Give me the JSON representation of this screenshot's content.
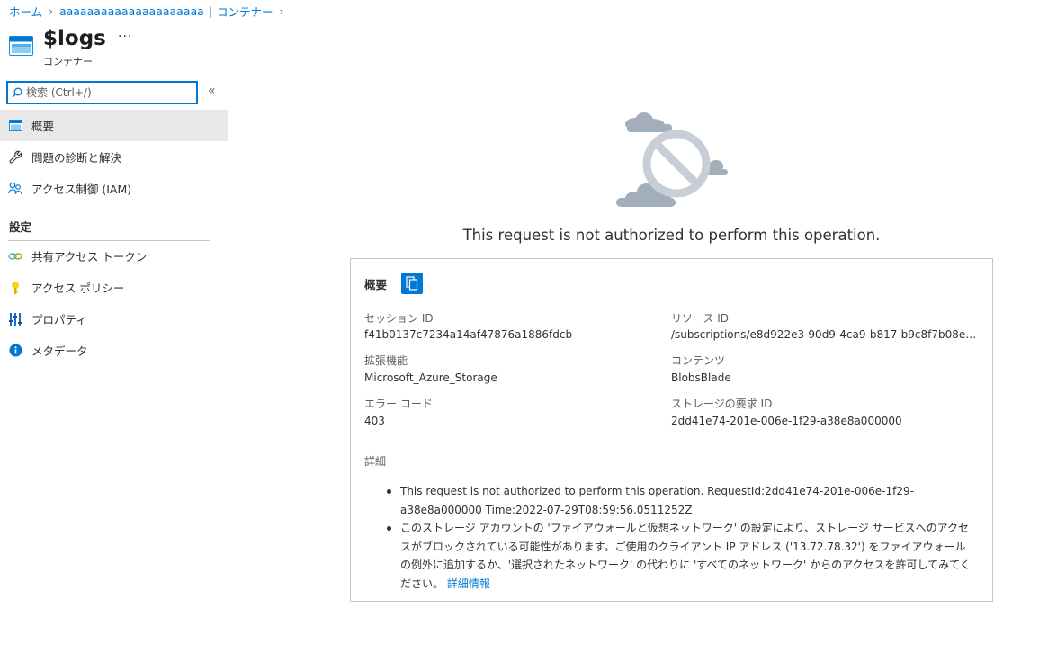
{
  "breadcrumb": {
    "home": "ホーム",
    "account": "aaaaaaaaaaaaaaaaaaaaa",
    "separator_pipe": "|",
    "containers": "コンテナー"
  },
  "header": {
    "title": "$logs",
    "subtitle": "コンテナー",
    "more": "···"
  },
  "search": {
    "placeholder": "検索 (Ctrl+/)",
    "value": ""
  },
  "nav": {
    "items": [
      {
        "label": "概要",
        "icon": "container-icon",
        "active": true
      },
      {
        "label": "問題の診断と解決",
        "icon": "wrench-icon",
        "active": false
      },
      {
        "label": "アクセス制御 (IAM)",
        "icon": "people-icon",
        "active": false
      }
    ],
    "settings_header": "設定",
    "settings_items": [
      {
        "label": "共有アクセス トークン",
        "icon": "link-icon"
      },
      {
        "label": "アクセス ポリシー",
        "icon": "key-icon"
      },
      {
        "label": "プロパティ",
        "icon": "properties-icon"
      },
      {
        "label": "メタデータ",
        "icon": "info-icon"
      }
    ]
  },
  "error": {
    "title": "This request is not authorized to perform this operation.",
    "summary_header": "概要",
    "fields": {
      "session_id_label": "セッション ID",
      "session_id_value": "f41b0137c7234a14af47876a1886fdcb",
      "resource_id_label": "リソース ID",
      "resource_id_value": "/subscriptions/e8d922e3-90d9-4ca9-b817-b9c8f7b08eb...",
      "extension_label": "拡張機能",
      "extension_value": "Microsoft_Azure_Storage",
      "content_label": "コンテンツ",
      "content_value": "BlobsBlade",
      "error_code_label": "エラー コード",
      "error_code_value": "403",
      "storage_request_id_label": "ストレージの要求 ID",
      "storage_request_id_value": "2dd41e74-201e-006e-1f29-a38e8a000000"
    },
    "details_label": "詳細",
    "details": {
      "item1": "This request is not authorized to perform this operation. RequestId:2dd41e74-201e-006e-1f29-a38e8a000000 Time:2022-07-29T08:59:56.0511252Z",
      "item2": "このストレージ アカウントの 'ファイアウォールと仮想ネットワーク' の設定により、ストレージ サービスへのアクセスがブロックされている可能性があります。ご使用のクライアント IP アドレス ('13.72.78.32') をファイアウォールの例外に追加するか、'選択されたネットワーク' の代わりに 'すべてのネットワーク' からのアクセスを許可してみてください。",
      "learn_more": "詳細情報"
    }
  },
  "colors": {
    "accent": "#0078d4",
    "active_nav_bg": "#e8e8e8",
    "text": "#323130"
  }
}
